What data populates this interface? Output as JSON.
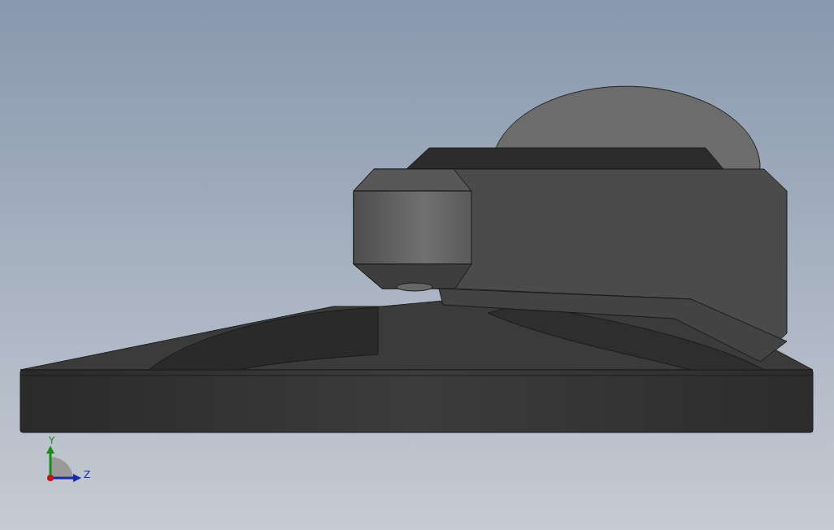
{
  "viewport": {
    "triad": {
      "labels": [
        "Y",
        "Z"
      ]
    }
  }
}
